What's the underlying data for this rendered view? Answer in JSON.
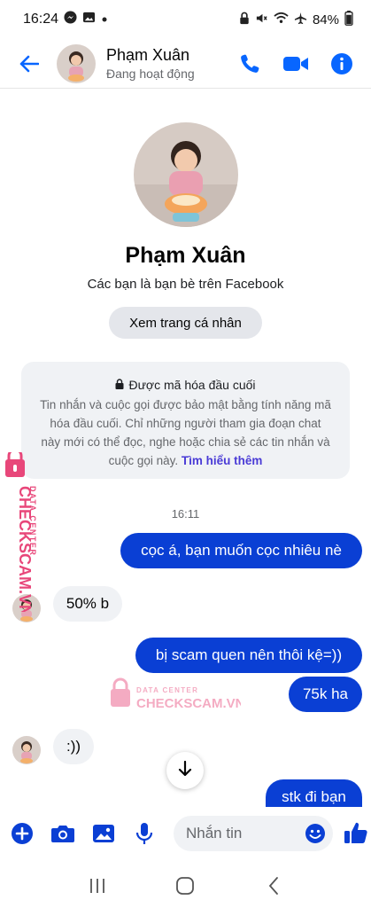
{
  "status_bar": {
    "time": "16:24",
    "battery": "84%"
  },
  "header": {
    "contact_name": "Phạm Xuân",
    "presence": "Đang hoạt động"
  },
  "profile": {
    "name": "Phạm Xuân",
    "subtitle": "Các bạn là bạn bè trên Facebook",
    "view_profile_label": "Xem trang cá nhân"
  },
  "encryption_notice": {
    "title": "Được mã hóa đầu cuối",
    "body": "Tin nhắn và cuộc gọi được bảo mật bằng tính năng mã hóa đầu cuối. Chỉ những người tham gia đoạn chat này mới có thể đọc, nghe hoặc chia sẻ các tin nhắn và cuộc gọi này.",
    "link": "Tìm hiểu thêm"
  },
  "conversation": {
    "timestamp": "16:11",
    "messages": [
      {
        "sender": "me",
        "text": "cọc á, bạn muốn cọc nhiêu nè"
      },
      {
        "sender": "contact",
        "text": "50% b"
      },
      {
        "sender": "me",
        "text": "bị scam quen nên thôi kệ=))"
      },
      {
        "sender": "me",
        "text": "75k ha"
      },
      {
        "sender": "contact",
        "text": ":))"
      },
      {
        "sender": "me",
        "text": "stk đi bạn"
      }
    ]
  },
  "watermark": {
    "label": "DATA CENTER",
    "brand": "CHECKSCAM.VN"
  },
  "composer": {
    "placeholder": "Nhắn tin"
  },
  "colors": {
    "accent": "#0866ff",
    "outgoing_bubble": "#0a3fd4",
    "incoming_bubble": "#f0f2f5",
    "watermark": "#e8477a"
  }
}
